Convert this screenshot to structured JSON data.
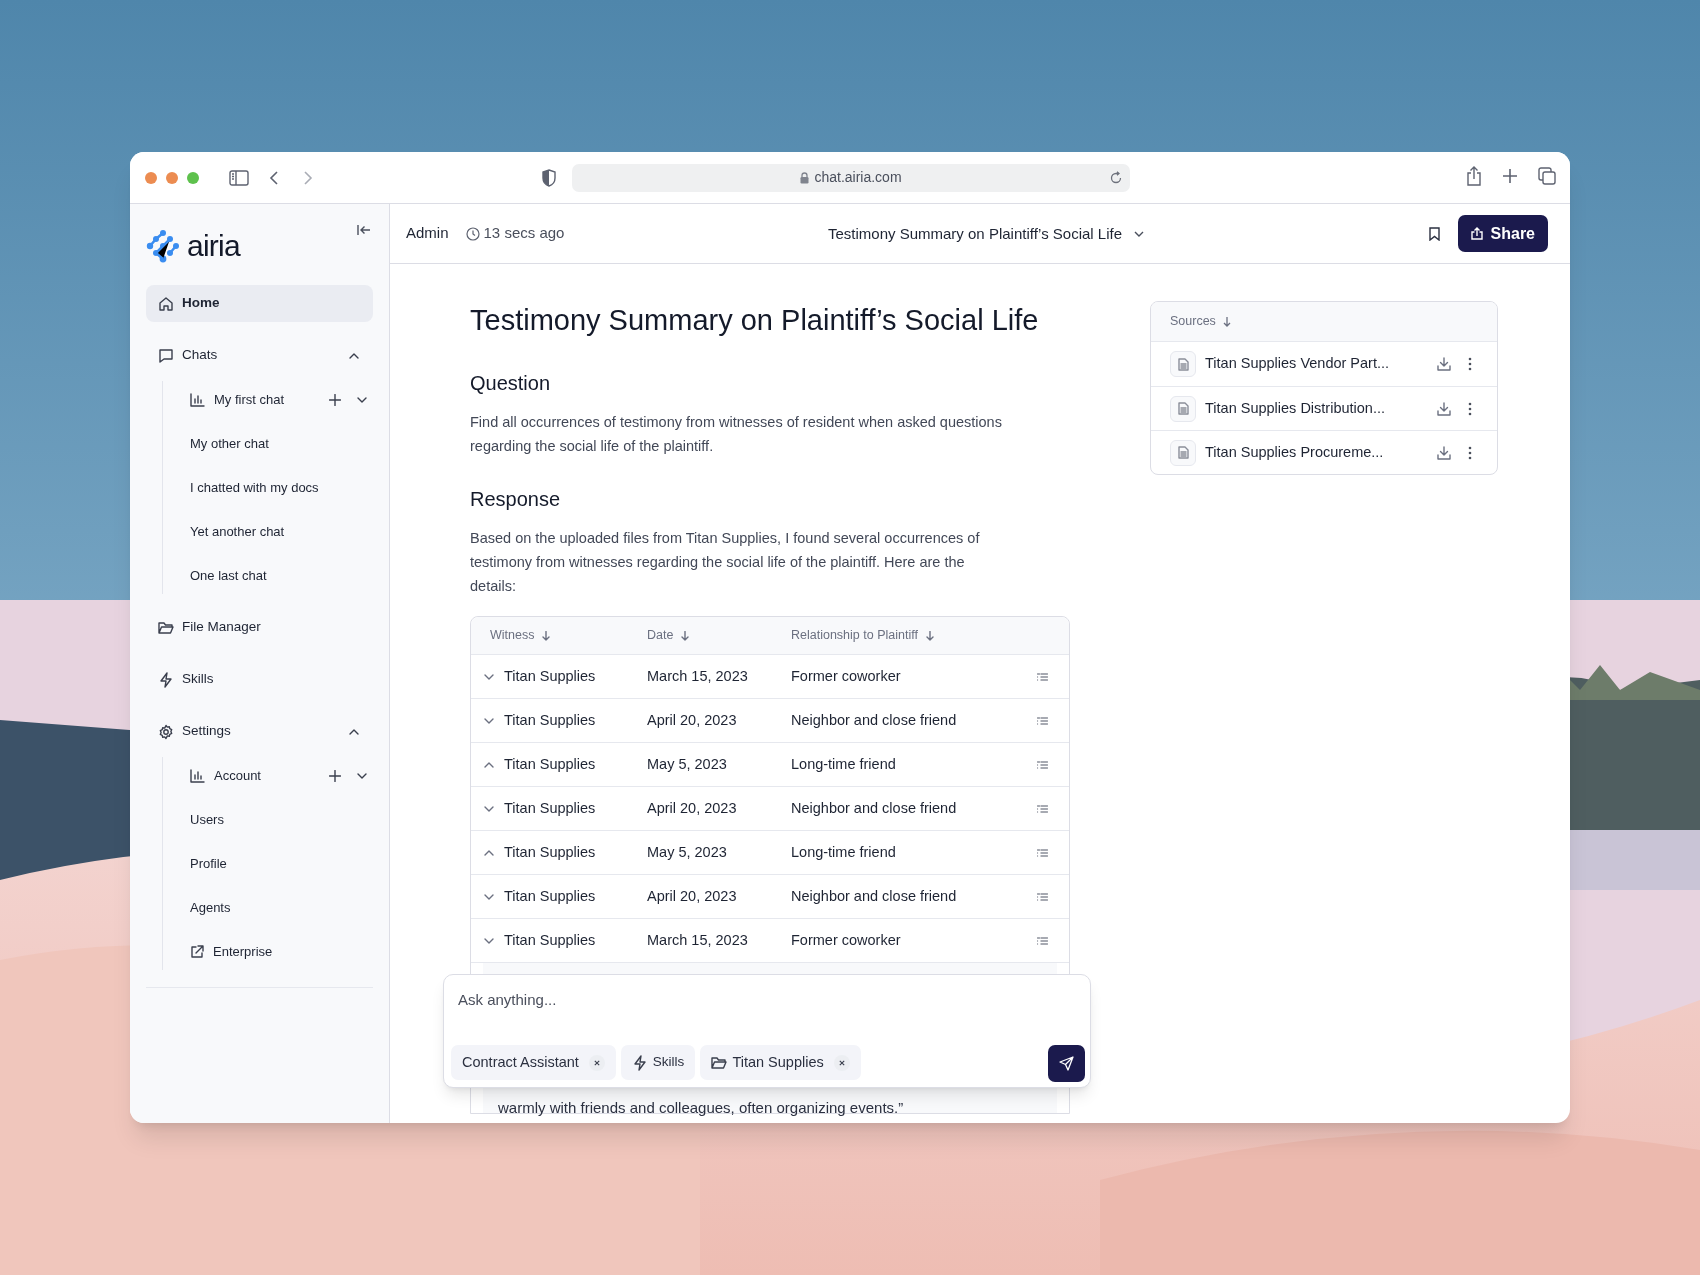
{
  "browser": {
    "url": "chat.airia.com"
  },
  "sidebar": {
    "logo": "airia",
    "items": [
      {
        "label": "Home",
        "selected": true
      },
      {
        "label": "Chats",
        "selected": false,
        "expanded": true,
        "children": [
          {
            "label": "My first chat",
            "kind": "group"
          },
          {
            "label": "My other chat",
            "kind": "plain"
          },
          {
            "label": "I chatted with my docs",
            "kind": "plain"
          },
          {
            "label": "Yet another chat",
            "kind": "plain"
          },
          {
            "label": "One last chat",
            "kind": "plain"
          }
        ]
      },
      {
        "label": "File Manager",
        "selected": false
      },
      {
        "label": "Skills",
        "selected": false
      },
      {
        "label": "Settings",
        "selected": false,
        "expanded": true,
        "children": [
          {
            "label": "Account",
            "kind": "group"
          },
          {
            "label": "Users",
            "kind": "plain"
          },
          {
            "label": "Profile",
            "kind": "plain"
          },
          {
            "label": "Agents",
            "kind": "plain"
          },
          {
            "label": "Enterprise",
            "kind": "external"
          }
        ]
      }
    ]
  },
  "header": {
    "user": "Admin",
    "time": "13 secs ago",
    "title": "Testimony Summary on Plaintiff’s Social Life",
    "share": "Share"
  },
  "document": {
    "title": "Testimony Summary on Plaintiff’s Social Life",
    "sections": [
      {
        "heading": "Question",
        "text": "Find all occurrences of testimony from witnesses of resident when asked questions regarding the social life of the plaintiff."
      },
      {
        "heading": "Response",
        "text": "Based on the uploaded files from Titan Supplies, I found several occurrences of testimony from witnesses regarding the social life of the plaintiff. Here are the details:"
      }
    ],
    "table": {
      "columns": [
        "Witness",
        "Date",
        "Relationship to Plaintiff"
      ],
      "rows": [
        {
          "witness": "Titan Supplies",
          "date": "March 15, 2023",
          "relationship": "Former coworker",
          "expanded": false
        },
        {
          "witness": "Titan Supplies",
          "date": "April 20, 2023",
          "relationship": "Neighbor and close friend",
          "expanded": false
        },
        {
          "witness": "Titan Supplies",
          "date": "May 5, 2023",
          "relationship": "Long-time friend",
          "expanded": true
        },
        {
          "witness": "Titan Supplies",
          "date": "April 20, 2023",
          "relationship": "Neighbor and close friend",
          "expanded": false
        },
        {
          "witness": "Titan Supplies",
          "date": "May 5, 2023",
          "relationship": "Long-time friend",
          "expanded": true
        },
        {
          "witness": "Titan Supplies",
          "date": "April 20, 2023",
          "relationship": "Neighbor and close friend",
          "expanded": false
        },
        {
          "witness": "Titan Supplies",
          "date": "March 15, 2023",
          "relationship": "Former coworker",
          "expanded": false
        }
      ],
      "detail_text": "warmly with friends and colleagues, often organizing events.”"
    }
  },
  "sources": {
    "title": "Sources",
    "items": [
      {
        "name": "Titan Supplies Vendor Part..."
      },
      {
        "name": "Titan Supplies Distribution..."
      },
      {
        "name": "Titan Supplies Procureme..."
      }
    ]
  },
  "composer": {
    "placeholder": "Ask anything...",
    "chips": [
      {
        "label": "Contract Assistant",
        "kind": "agent"
      },
      {
        "label": "Skills",
        "kind": "skills"
      },
      {
        "label": "Titan Supplies",
        "kind": "folder"
      }
    ]
  }
}
